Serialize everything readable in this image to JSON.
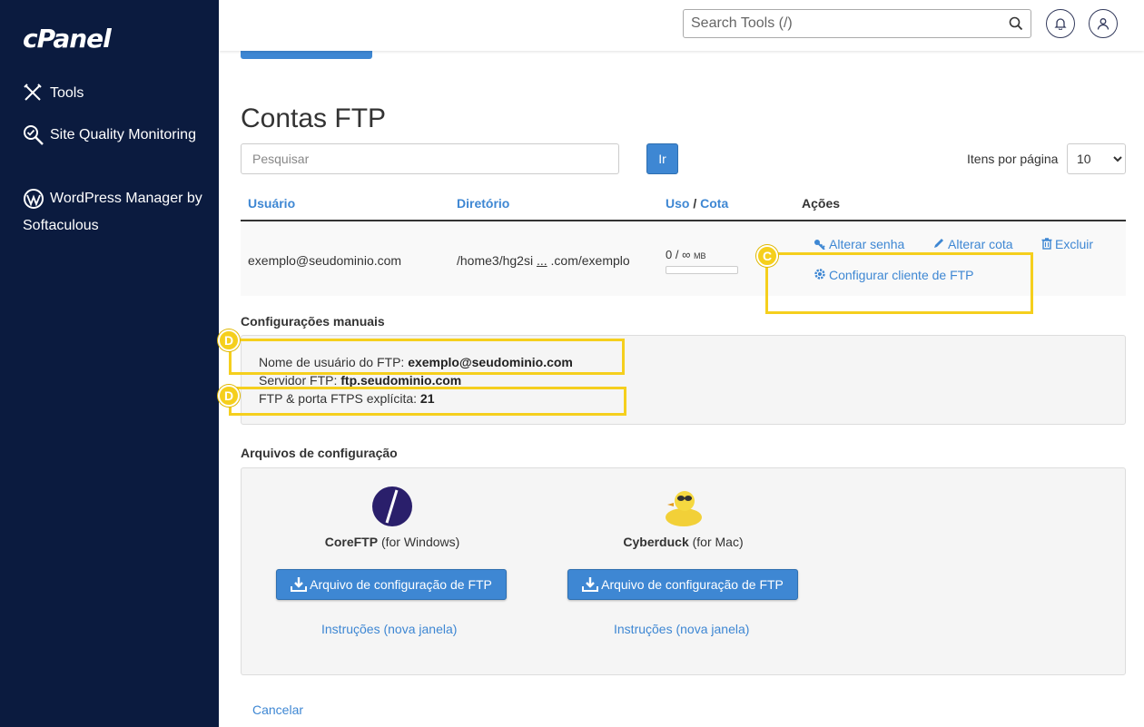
{
  "sidebar": {
    "logo": "cPanel",
    "items": [
      {
        "label": "Tools",
        "icon": "tools-icon"
      },
      {
        "label": "Site Quality Monitoring",
        "icon": "magnifier-check-icon"
      },
      {
        "label": "WordPress Manager by Softaculous",
        "icon": "wordpress-icon"
      }
    ]
  },
  "header": {
    "search_placeholder": "Search Tools (/)"
  },
  "main": {
    "title": "Contas FTP",
    "search_placeholder": "Pesquisar",
    "go_label": "Ir",
    "per_page_label": "Itens por página",
    "per_page_value": "10",
    "table": {
      "headers": {
        "user": "Usuário",
        "directory": "Diretório",
        "usage": "Uso",
        "separator": "/",
        "quota": "Cota",
        "actions": "Ações"
      },
      "row": {
        "user": "exemplo@seudominio.com",
        "dir_start": "/home3/hg2si",
        "dir_ellipsis": "...",
        "dir_end": ".com/exemplo",
        "usage": "0 / ∞",
        "usage_unit": "MB",
        "usage_fraction": 0,
        "actions": {
          "change_password": "Alterar senha",
          "change_quota": "Alterar cota",
          "delete": "Excluir",
          "configure_client": "Configurar cliente de FTP"
        }
      }
    },
    "badges": {
      "c": "C",
      "d": "D"
    },
    "manual": {
      "title": "Configurações manuais",
      "username_label": "Nome de usuário do FTP:",
      "username_value": "exemplo@seudominio.com",
      "server_label": "Servidor FTP:",
      "server_value": "ftp.seudominio.com",
      "port_label": "FTP & porta FTPS explícita:",
      "port_value": "21"
    },
    "config_files": {
      "title": "Arquivos de configuração",
      "clients": [
        {
          "name": "CoreFTP",
          "platform": "(for Windows)",
          "button": "Arquivo de configuração de FTP",
          "instructions": "Instruções (nova janela)"
        },
        {
          "name": "Cyberduck",
          "platform": "(for Mac)",
          "button": "Arquivo de configuração de FTP",
          "instructions": "Instruções (nova janela)"
        }
      ]
    },
    "cancel_label": "Cancelar"
  },
  "colors": {
    "sidebar_bg": "#0b1b3f",
    "accent": "#3e87d3",
    "highlight": "#f5cf1d"
  }
}
